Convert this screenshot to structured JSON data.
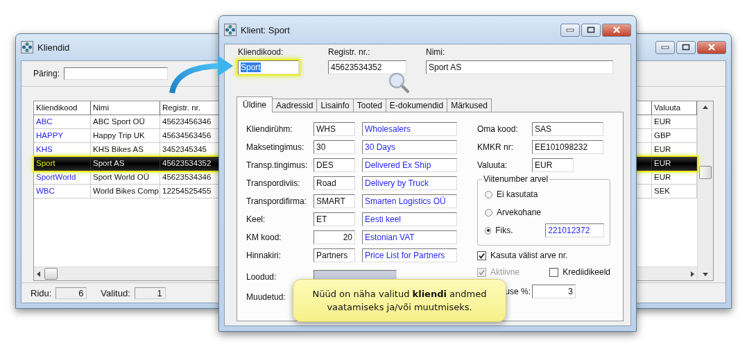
{
  "list_window": {
    "title": "Kliendid",
    "query_label": "Päring:",
    "table": {
      "columns": [
        "Kliendikood",
        "Nimi",
        "Registr. nr.",
        "Valuuta"
      ],
      "rows": [
        {
          "code": "ABC",
          "name": "ABC Sport OÜ",
          "reg_nr": "45623456346",
          "currency": "EUR",
          "selected": false
        },
        {
          "code": "HAPPY",
          "name": "Happy Trip UK",
          "reg_nr": "45634563456",
          "currency": "GBP",
          "selected": false
        },
        {
          "code": "KHS",
          "name": "KHS Bikes AS",
          "reg_nr": "3452345345",
          "currency": "EUR",
          "selected": false
        },
        {
          "code": "Sport",
          "name": "Sport AS",
          "reg_nr": "45623534352",
          "currency": "EUR",
          "selected": true
        },
        {
          "code": "SportWorld",
          "name": "Sport World OÜ",
          "reg_nr": "45623534346",
          "currency": "EUR",
          "selected": false
        },
        {
          "code": "WBC",
          "name": "World Bikes Comp",
          "reg_nr": "12254525455",
          "currency": "SEK",
          "selected": false
        }
      ]
    },
    "status": {
      "rows_label": "Ridu:",
      "rows_value": "6",
      "selected_label": "Valitud:",
      "selected_value": "1"
    }
  },
  "client_window": {
    "title": "Klient: Sport",
    "header_fields": [
      {
        "label": "Kliendikood:",
        "value": "Sport",
        "highlighted": true
      },
      {
        "label": "Registr. nr.:",
        "value": "45623534352",
        "highlighted": false
      },
      {
        "label": "Nimi:",
        "value": "Sport AS",
        "highlighted": false
      }
    ],
    "tabs": [
      {
        "label": "Üldine",
        "selected": true
      },
      {
        "label": "Aadressid",
        "selected": false
      },
      {
        "label": "Lisainfo",
        "selected": false
      },
      {
        "label": "Tooted",
        "selected": false
      },
      {
        "label": "E-dokumendid",
        "selected": false
      },
      {
        "label": "Märkused",
        "selected": false
      }
    ],
    "left_fields": [
      {
        "label": "Kliendirühm:",
        "code": "WHS",
        "description": "Wholesalers",
        "kind": "text"
      },
      {
        "label": "Maksetingimus:",
        "code": "30",
        "description": "30 Days",
        "kind": "text"
      },
      {
        "label": "Transp.tingimus:",
        "code": "DES",
        "description": "Delivered Ex Ship",
        "kind": "text"
      },
      {
        "label": "Transpordiviis:",
        "code": "Road",
        "description": "Delivery by Truck",
        "kind": "text"
      },
      {
        "label": "Transpordifirma:",
        "code": "SMART",
        "description": "Smarten Logistics OÜ",
        "kind": "text"
      },
      {
        "label": "Keel:",
        "code": "ET",
        "description": "Eesti keel",
        "kind": "text"
      },
      {
        "label": "KM kood:",
        "code": "20",
        "description": "Estonian VAT",
        "kind": "number"
      },
      {
        "label": "Hinnakiri:",
        "code": "Partners",
        "description": "Price List for Partners",
        "kind": "text"
      }
    ],
    "created_label": "Loodud:",
    "modified_label": "Muudetud:",
    "right_fields": [
      {
        "label": "Oma kood:",
        "value": "SAS"
      },
      {
        "label": "KMKR nr:",
        "value": "EE101098232"
      },
      {
        "label": "Valuuta:",
        "value": "EUR"
      }
    ],
    "reference_group": {
      "title": "Viitenumber arvel",
      "options": [
        {
          "label": "Ei kasutata",
          "selected": false
        },
        {
          "label": "Arvekohane",
          "selected": false
        },
        {
          "label": "Fiks.",
          "selected": true,
          "value": "221012372"
        }
      ]
    },
    "checkboxes": [
      {
        "label": "Kasuta välist arve nr.",
        "checked": true,
        "disabled": false
      },
      {
        "label": "Aktiivne",
        "checked": true,
        "disabled": true
      },
      {
        "label": "Krediidikeeld",
        "checked": false,
        "disabled": false
      }
    ],
    "discount": {
      "label": "use %:",
      "value": "3"
    }
  },
  "callout": {
    "text": "Nüüd on näha valitud **kliendi** andmed vaatamiseks ja/või muutmiseks."
  }
}
